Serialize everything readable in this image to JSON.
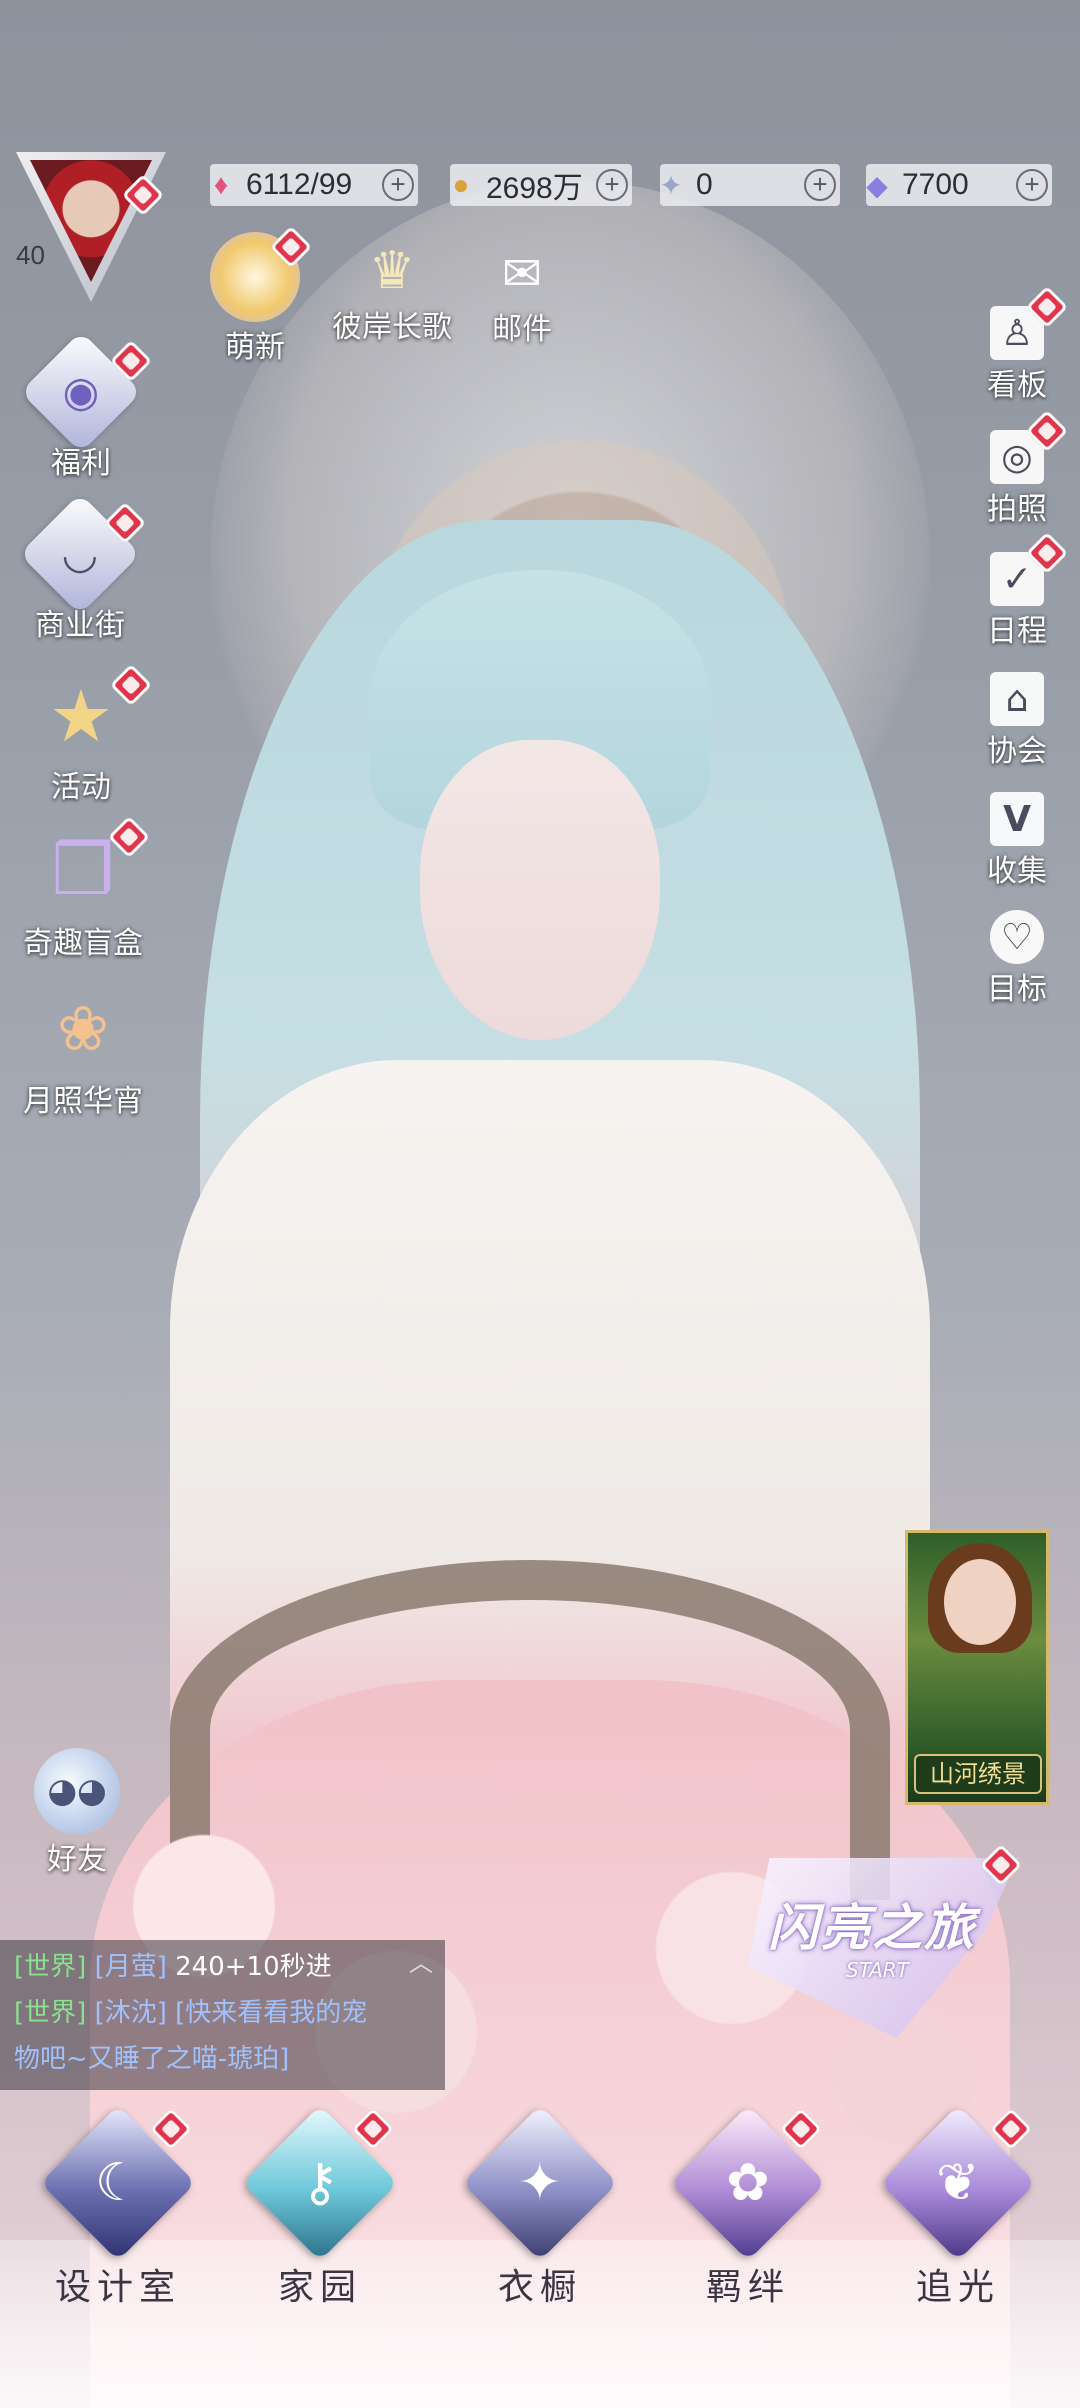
{
  "player": {
    "level": "40"
  },
  "currencies": [
    {
      "icon": "pink-gem-icon",
      "value": "6112/99"
    },
    {
      "icon": "gold-coin-icon",
      "value": "2698万"
    },
    {
      "icon": "crystal-icon",
      "value": "0"
    },
    {
      "icon": "diamond-icon",
      "value": "7700"
    }
  ],
  "top_center": [
    {
      "label": "萌新",
      "icon": "crystal-ball-icon"
    },
    {
      "label": "彼岸长歌",
      "icon": "crown-icon"
    },
    {
      "label": "邮件",
      "icon": "mail-icon"
    }
  ],
  "left_menu": [
    {
      "label": "福利",
      "icon": "balloon-icon"
    },
    {
      "label": "商业街",
      "icon": "shop-icon"
    },
    {
      "label": "活动",
      "icon": "star-icon"
    },
    {
      "label": "奇趣盲盒",
      "icon": "gift-box-icon"
    },
    {
      "label": "月照华宵",
      "icon": "lantern-icon"
    }
  ],
  "right_menu": [
    {
      "label": "看板",
      "icon": "mannequin-icon"
    },
    {
      "label": "拍照",
      "icon": "camera-icon"
    },
    {
      "label": "日程",
      "icon": "calendar-icon"
    },
    {
      "label": "协会",
      "icon": "guild-icon"
    },
    {
      "label": "收集",
      "icon": "collection-icon"
    },
    {
      "label": "目标",
      "icon": "target-icon"
    }
  ],
  "friends": {
    "label": "好友"
  },
  "chat": {
    "lines": [
      {
        "tag": "[世界]",
        "name": "[月萤]",
        "text": " 240+10秒进"
      },
      {
        "tag": "[世界]",
        "name": "[沐沈]",
        "text": " [快来看看我的宠"
      },
      {
        "tag": "",
        "name": "",
        "text": "物吧~又睡了之喵-琥珀]"
      }
    ]
  },
  "event_banner": {
    "caption": "山河绣景"
  },
  "journey": {
    "title": "闪亮之旅",
    "subtitle": "START"
  },
  "bottom_nav": [
    {
      "label": "设计室",
      "icon": "moon-icon"
    },
    {
      "label": "家园",
      "icon": "key-icon"
    },
    {
      "label": "衣橱",
      "icon": "sparkle-icon"
    },
    {
      "label": "羁绊",
      "icon": "flower-icon"
    },
    {
      "label": "追光",
      "icon": "butterfly-icon"
    }
  ],
  "colors": {
    "badge": "#e0354c",
    "chat_tag": "#8be08f",
    "chat_name": "#9fc2ff"
  }
}
